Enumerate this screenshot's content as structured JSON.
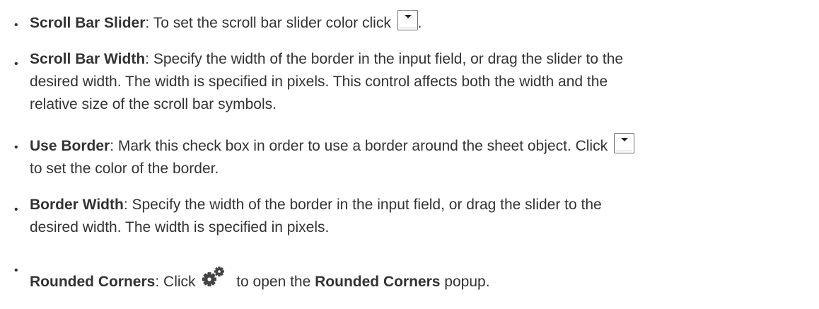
{
  "items": [
    {
      "term": "Scroll Bar Slider",
      "sep": ":",
      "before": " To set the scroll bar slider color click ",
      "after": "."
    },
    {
      "term": "Scroll Bar Width",
      "sep": ":",
      "line1": " Specify the width of the border in the input field, or drag the slider to the",
      "line2": "desired width. The width is specified in pixels. This control affects both the width and the",
      "line3": "relative size of the scroll bar symbols."
    },
    {
      "term": "Use Border",
      "sep": ":",
      "line1": " Mark this check box in order to use a border around the sheet object. Click ",
      "line2": "to set the color of the border."
    },
    {
      "term": "Border Width",
      "sep": ":",
      "line1": " Specify the width of the border in the input field, or drag the slider to the",
      "line2": "desired width. The width is specified in pixels."
    },
    {
      "term": "Rounded Corners",
      "sep": ":",
      "before": " Click ",
      "middle": " to open the ",
      "strong": "Rounded Corners",
      "after": " popup."
    }
  ],
  "bullet": "•",
  "icons": {
    "color_button": "color-dropdown-icon",
    "settings": "gear-icon"
  },
  "colors": {
    "text": "#333333",
    "gear": "#444444"
  }
}
